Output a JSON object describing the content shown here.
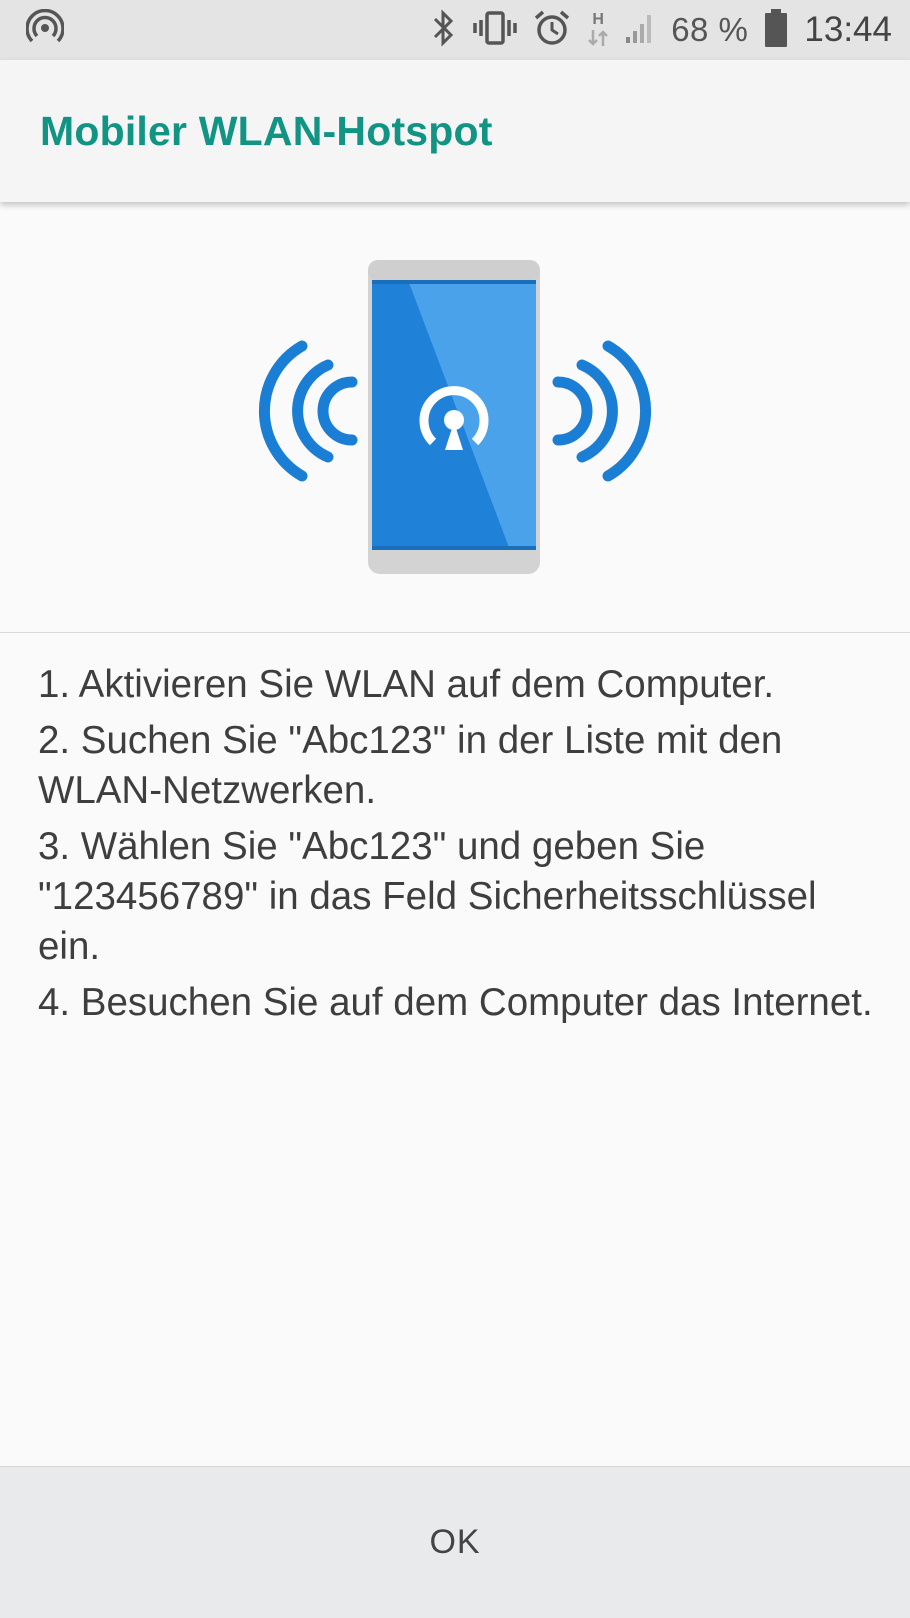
{
  "status_bar": {
    "battery_percent": "68 %",
    "time": "13:44",
    "network_type": "H",
    "icons": [
      "hotspot-icon",
      "bluetooth-icon",
      "vibrate-icon",
      "alarm-icon",
      "network-h-icon",
      "signal-icon",
      "battery-icon"
    ]
  },
  "app_bar": {
    "title": "Mobiler WLAN-Hotspot",
    "accent_color": "#119484"
  },
  "illustration": {
    "icon": "phone-hotspot-icon",
    "phone_color": "#2b8fe0",
    "wave_color": "#1a7fd4"
  },
  "instructions": {
    "steps": [
      "1. Aktivieren Sie WLAN auf dem Computer.",
      "2. Suchen Sie \"Abc123\" in der Liste mit den WLAN-Netzwerken.",
      "3. Wählen Sie \"Abc123\" und geben Sie \"123456789\" in das Feld Sicherheitsschlüssel ein.",
      "4. Besuchen Sie auf dem Computer das Internet."
    ]
  },
  "footer": {
    "ok_label": "OK"
  }
}
